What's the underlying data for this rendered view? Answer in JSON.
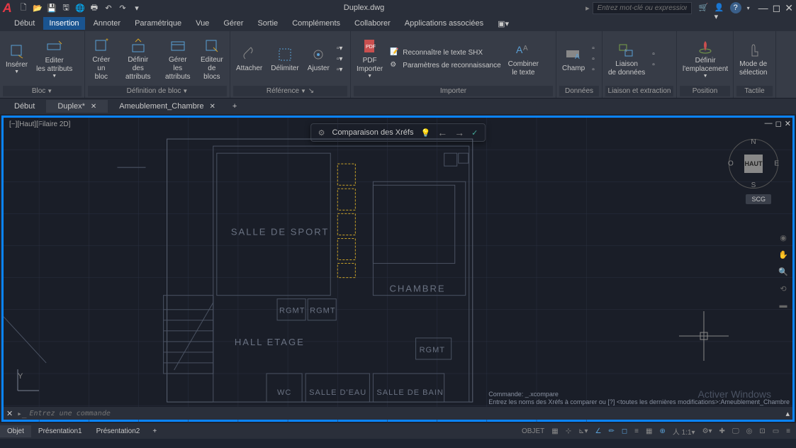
{
  "title": "Duplex.dwg",
  "search_placeholder": "Entrez mot-clé ou expression",
  "menus": [
    "Début",
    "Insertion",
    "Annoter",
    "Paramétrique",
    "Vue",
    "Gérer",
    "Sortie",
    "Compléments",
    "Collaborer",
    "Applications associées"
  ],
  "active_menu": "Insertion",
  "ribbon": {
    "bloc": {
      "title": "Bloc",
      "inserer": "Insérer",
      "editer": "Editer\nles attributs"
    },
    "defbloc": {
      "title": "Définition de bloc",
      "creer": "Créer\nun bloc",
      "definir": "Définir\ndes attributs",
      "gerer": "Gérer les\nattributs",
      "editeur": "Editeur\nde blocs"
    },
    "reference": {
      "title": "Référence",
      "attacher": "Attacher",
      "delimiter": "Délimiter",
      "ajuster": "Ajuster"
    },
    "importer": {
      "title": "Importer",
      "pdf": "PDF\nImporter",
      "shx": "Reconnaître le texte SHX",
      "params": "Paramètres de reconnaissance",
      "combiner": "Combiner\nle texte"
    },
    "donnees": {
      "title": "Données",
      "champ": "Champ"
    },
    "liaison": {
      "title": "Liaison et extraction",
      "liaison": "Liaison\nde données"
    },
    "position": {
      "title": "Position",
      "definir": "Définir\nl'emplacement"
    },
    "tactile": {
      "title": "Tactile",
      "mode": "Mode de\nsélection"
    }
  },
  "file_tabs": [
    {
      "label": "Début",
      "closable": false
    },
    {
      "label": "Duplex*",
      "closable": true,
      "active": true
    },
    {
      "label": "Ameublement_Chambre",
      "closable": true
    }
  ],
  "viewport_label": "[−][Haut][Filaire 2D]",
  "xref_bar": "Comparaison des Xréfs",
  "compass": {
    "center": "HAUT",
    "n": "N",
    "s": "S",
    "e": "E",
    "w": "O"
  },
  "scg": "SCG",
  "rooms": {
    "sport": "SALLE DE SPORT",
    "chambre": "CHAMBRE",
    "hall": "HALL ETAGE",
    "rgmt": "RGMT",
    "wc": "WC",
    "eau": "SALLE D'EAU",
    "bain": "SALLE DE BAIN"
  },
  "cmd_history": [
    "Commande: _.xcompare",
    "Entrez les noms des Xréfs à comparer ou [?] <toutes les dernières modifications>:Ameublement_Chambre"
  ],
  "cmd_placeholder": "Entrez une commande",
  "layout_tabs": [
    "Objet",
    "Présentation1",
    "Présentation2"
  ],
  "status_objet": "OBJET",
  "watermark": "Activer Windows",
  "ucs_y": "Y"
}
